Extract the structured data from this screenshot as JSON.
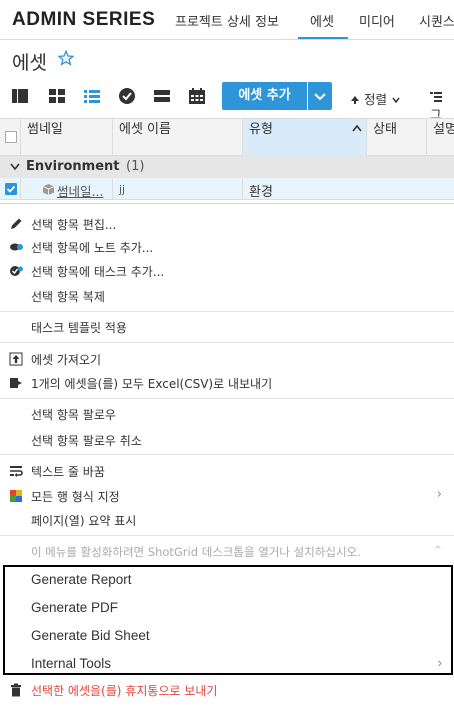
{
  "nav": {
    "brand": "ADMIN SERIES",
    "tabs": [
      "프로젝트 상세 정보",
      "에셋",
      "미디어",
      "시퀀스"
    ],
    "active_tab": "에셋",
    "accent_color": "#2d95d8"
  },
  "page": {
    "title": "에셋",
    "favorite_icon": "star-outline-icon"
  },
  "toolbar": {
    "view_icons": [
      "columns-icon",
      "grid-icon",
      "list-icon",
      "check-circle-icon",
      "rows-icon",
      "calendar-icon"
    ],
    "add_button": "에셋 추가",
    "sort_label": "정렬",
    "filter_label": "그"
  },
  "table": {
    "columns": [
      "썸네일",
      "에셋 이름",
      "유형",
      "상태",
      "설명"
    ],
    "sorted_column": "유형",
    "group": {
      "label": "Environment",
      "count": "(1)"
    },
    "rows": [
      {
        "thumbnail": "썸네일...",
        "name": "jj",
        "type": "환경",
        "selected": true
      }
    ]
  },
  "menu": {
    "items": [
      {
        "label": "선택 항목 편집...",
        "icon": "pencil-icon"
      },
      {
        "label": "선택 항목에 노트 추가...",
        "icon": "add-note-icon"
      },
      {
        "label": "선택 항목에 태스크 추가...",
        "icon": "add-task-icon"
      },
      {
        "label": "선택 항목 복제",
        "icon": ""
      },
      {
        "label": "태스크 템플릿 적용",
        "icon": ""
      },
      {
        "label": "에셋 가져오기",
        "icon": "import-icon"
      },
      {
        "label": "1개의 에셋을(를) 모두 Excel(CSV)로 내보내기",
        "icon": "export-icon"
      },
      {
        "label": "선택 항목 팔로우",
        "icon": ""
      },
      {
        "label": "선택 항목 팔로우 취소",
        "icon": ""
      },
      {
        "label": "텍스트 줄 바꿈",
        "icon": "wrap-text-icon"
      },
      {
        "label": "모든 행 형식 지정",
        "icon": "color-grid-icon"
      },
      {
        "label": "페이지(열) 요약 표시",
        "icon": ""
      },
      {
        "label": "이 메뉴를 활성화하려면 ShotGrid 데스크톱을 열거나 설치하십시오.",
        "icon": ""
      },
      {
        "label": "Generate Report",
        "icon": ""
      },
      {
        "label": "Generate PDF",
        "icon": ""
      },
      {
        "label": "Generate Bid Sheet",
        "icon": ""
      },
      {
        "label": "Internal Tools",
        "icon": ""
      },
      {
        "label": "선택한 에셋을(를) 휴지통으로 보내기",
        "icon": "trash-icon"
      }
    ],
    "danger_color": "#e0453a"
  }
}
